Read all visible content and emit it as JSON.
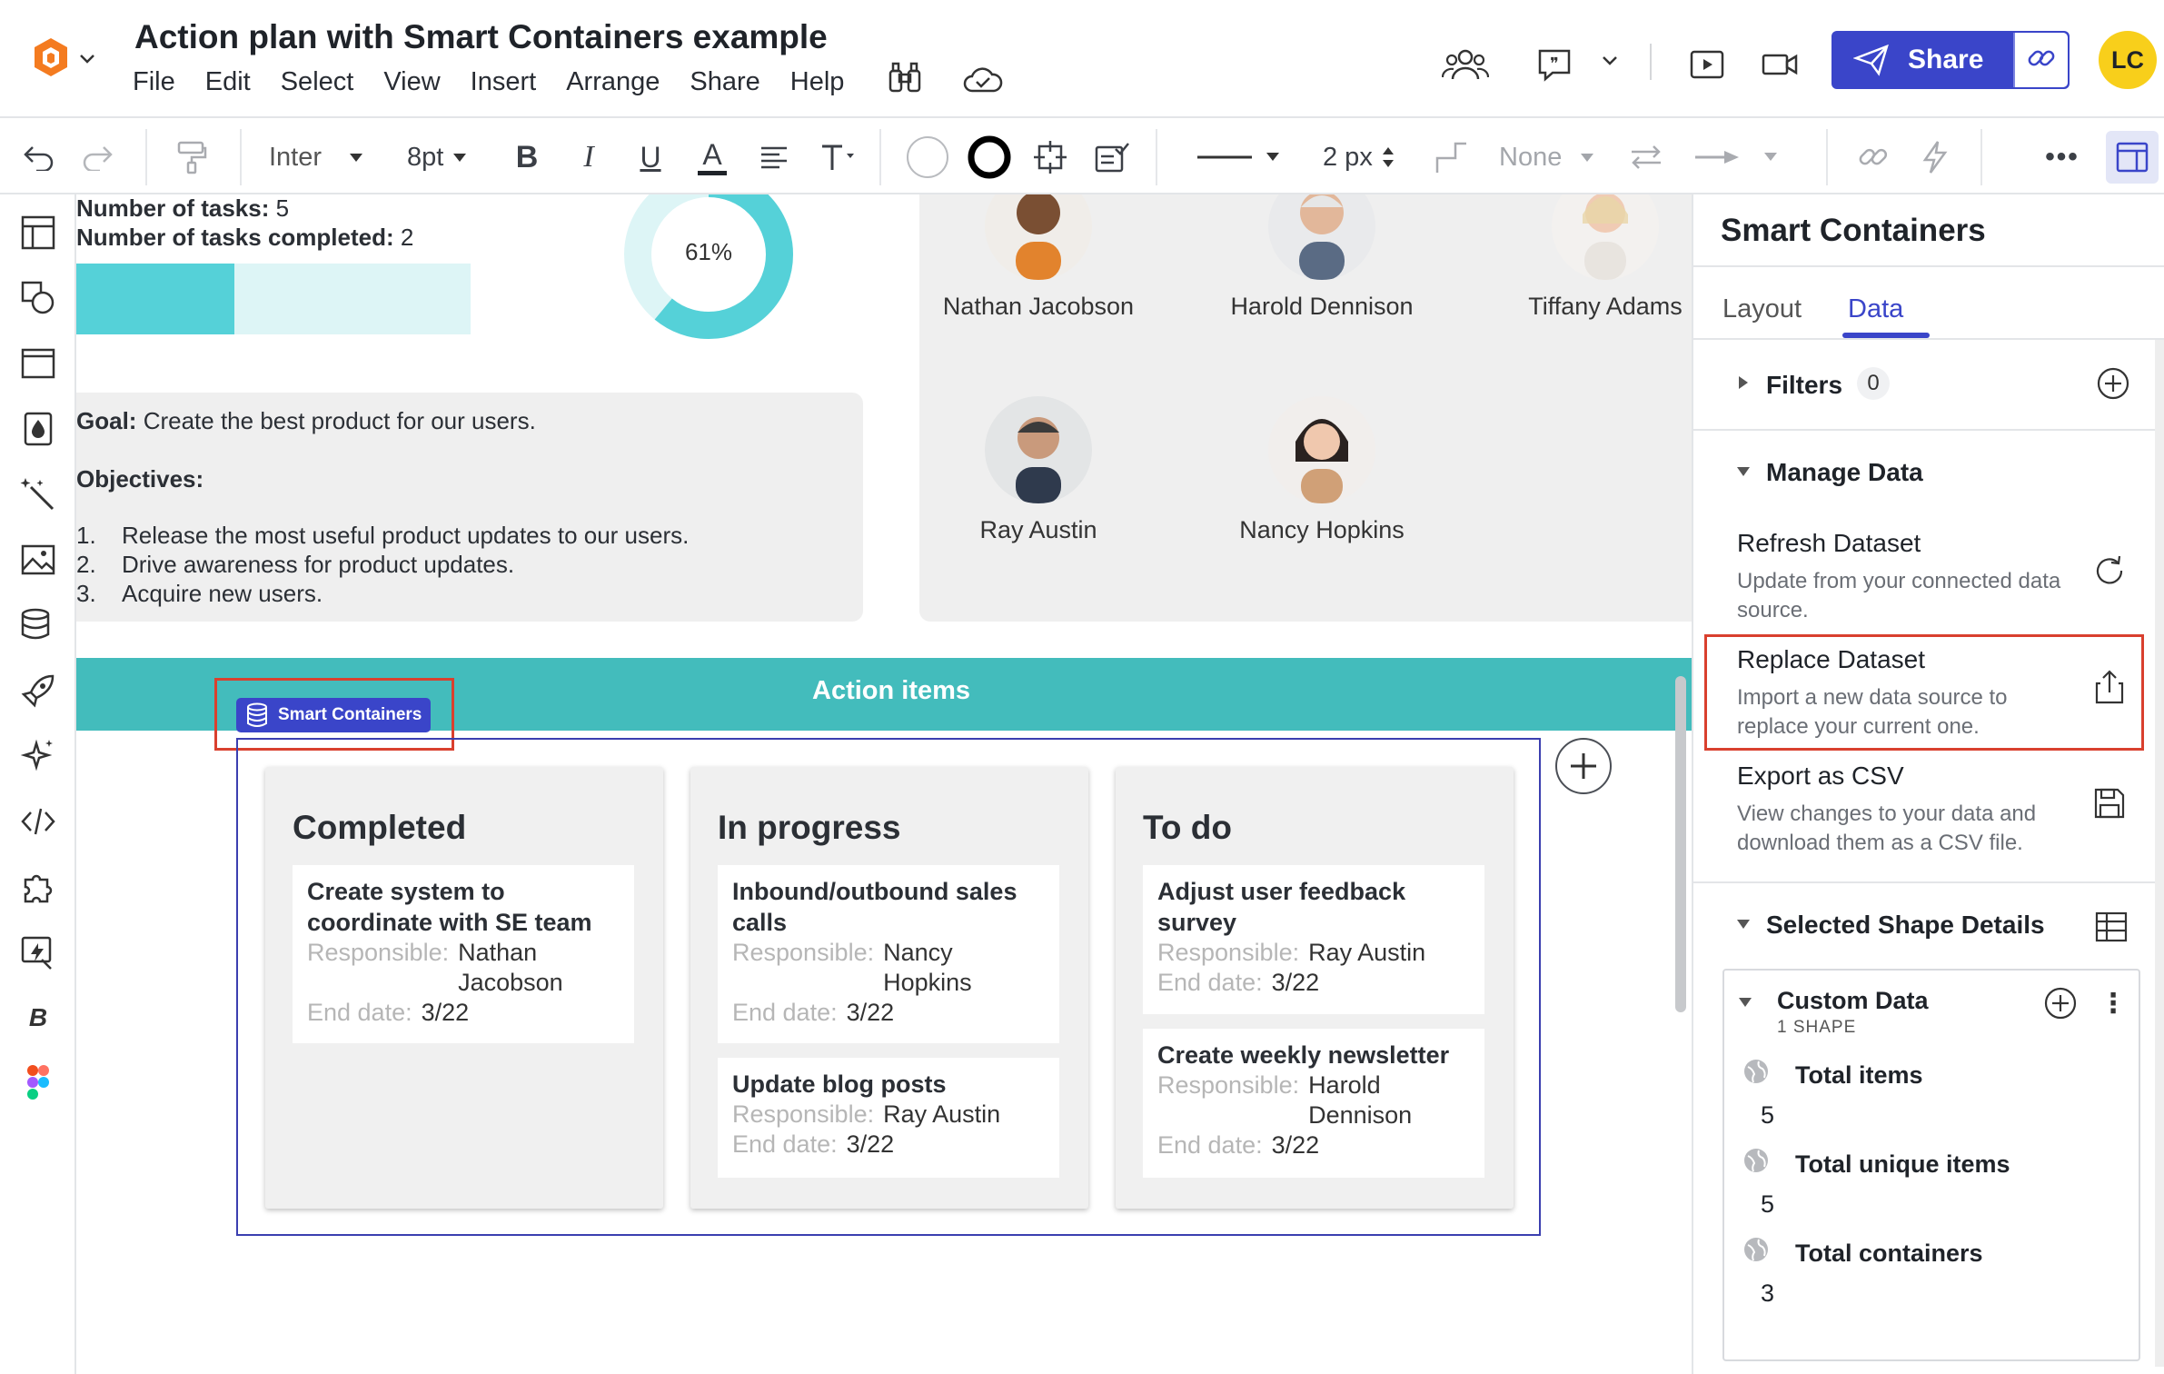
{
  "header": {
    "title": "Action plan with Smart Containers example",
    "menu": [
      "File",
      "Edit",
      "Select",
      "View",
      "Insert",
      "Arrange",
      "Share",
      "Help"
    ],
    "share_label": "Share",
    "user_initials": "LC",
    "accent_color": "#3a45c9"
  },
  "toolbar": {
    "font": "Inter",
    "font_size": "8pt",
    "line_width": "2 px",
    "endpoint": "None"
  },
  "canvas": {
    "tasks_label": "Number of tasks:",
    "tasks_value": "5",
    "completed_label": "Number of tasks completed:",
    "completed_value": "2",
    "progress_fraction": 0.4,
    "donut_label": "61%",
    "donut_fraction": 0.61,
    "goal_label": "Goal:",
    "goal_text": "Create the best product for our users.",
    "objectives_label": "Objectives:",
    "objectives": [
      {
        "num": "1.",
        "text": "Release the most useful product updates to our users."
      },
      {
        "num": "2.",
        "text": "Drive awareness for product updates."
      },
      {
        "num": "3.",
        "text": "Acquire new users."
      }
    ],
    "people": [
      "Nathan Jacobson",
      "Harold Dennison",
      "Tiffany Adams",
      "Ray Austin",
      "Nancy Hopkins"
    ],
    "action_items_title": "Action items",
    "smart_containers_badge": "Smart Containers",
    "columns": [
      {
        "title": "Completed",
        "cards": [
          {
            "title": "Create system to coordinate with SE team",
            "responsible_label": "Responsible:",
            "responsible": "Nathan Jacobson",
            "end_label": "End date:",
            "end": "3/22"
          }
        ]
      },
      {
        "title": "In progress",
        "cards": [
          {
            "title": "Inbound/outbound sales calls",
            "responsible_label": "Responsible:",
            "responsible": "Nancy Hopkins",
            "end_label": "End date:",
            "end": "3/22"
          },
          {
            "title": "Update blog posts",
            "responsible_label": "Responsible:",
            "responsible": "Ray Austin",
            "end_label": "End date:",
            "end": "3/22"
          }
        ]
      },
      {
        "title": "To do",
        "cards": [
          {
            "title": "Adjust user feedback survey",
            "responsible_label": "Responsible:",
            "responsible": "Ray Austin",
            "end_label": "End date:",
            "end": "3/22"
          },
          {
            "title": "Create weekly newsletter",
            "responsible_label": "Responsible:",
            "responsible": "Harold Dennison",
            "end_label": "End date:",
            "end": "3/22"
          }
        ]
      }
    ]
  },
  "panel": {
    "title": "Smart Containers",
    "tabs": [
      "Layout",
      "Data"
    ],
    "active_tab": "Data",
    "filters_label": "Filters",
    "filters_count": "0",
    "manage_data_label": "Manage Data",
    "items": [
      {
        "title": "Refresh Dataset",
        "desc": "Update from your connected data source."
      },
      {
        "title": "Replace Dataset",
        "desc": "Import a new data source to replace your current one."
      },
      {
        "title": "Export as CSV",
        "desc": "View changes to your data and download them as a CSV file."
      }
    ],
    "selected_shape_label": "Selected Shape Details",
    "custom_data_label": "Custom Data",
    "custom_data_sub": "1 SHAPE",
    "fields": [
      {
        "label": "Total items",
        "value": "5"
      },
      {
        "label": "Total unique items",
        "value": "5"
      },
      {
        "label": "Total containers",
        "value": "3"
      }
    ]
  }
}
